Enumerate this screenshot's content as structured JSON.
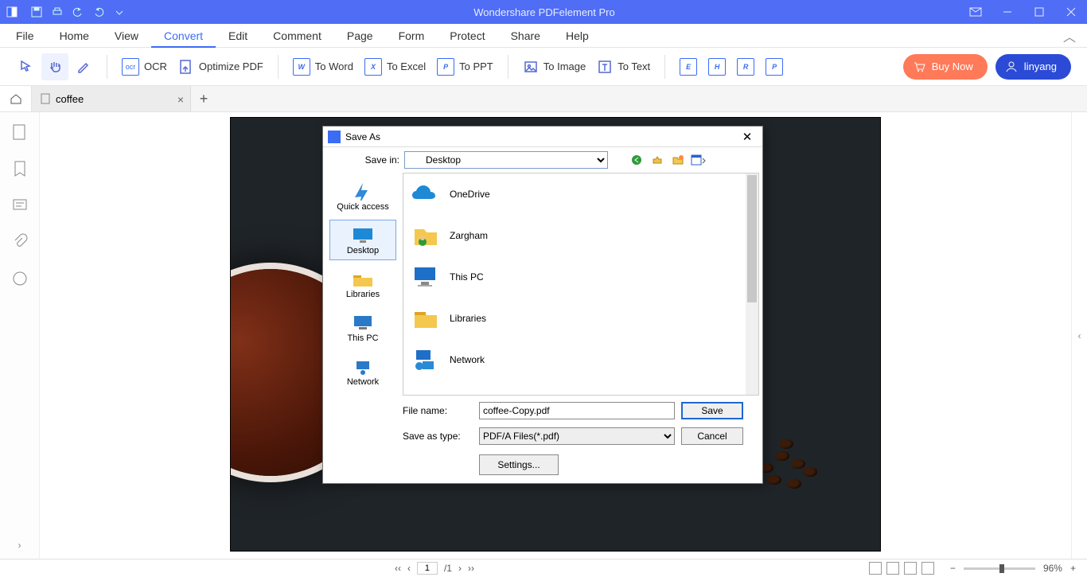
{
  "app": {
    "title": "Wondershare PDFelement Pro"
  },
  "qat": [
    "save",
    "print",
    "undo",
    "redo",
    "more"
  ],
  "menu": {
    "items": [
      "File",
      "Home",
      "View",
      "Convert",
      "Edit",
      "Comment",
      "Page",
      "Form",
      "Protect",
      "Share",
      "Help"
    ],
    "active_index": 3
  },
  "toolbar": {
    "ocr": "OCR",
    "optimize": "Optimize PDF",
    "to_word": "To Word",
    "to_excel": "To Excel",
    "to_ppt": "To PPT",
    "to_image": "To Image",
    "to_text": "To Text",
    "buy": "Buy Now",
    "user": "linyang"
  },
  "tabs": {
    "doc_name": "coffee"
  },
  "status": {
    "page_current": "1",
    "page_total": "/1",
    "zoom": "96%"
  },
  "dialog": {
    "title": "Save As",
    "savein_label": "Save in:",
    "savein_value": "Desktop",
    "places": [
      "Quick access",
      "Desktop",
      "Libraries",
      "This PC",
      "Network"
    ],
    "places_selected_index": 1,
    "files": [
      "OneDrive",
      "Zargham",
      "This PC",
      "Libraries",
      "Network"
    ],
    "filename_label": "File name:",
    "filename_value": "coffee-Copy.pdf",
    "type_label": "Save as type:",
    "type_value": "PDF/A Files(*.pdf)",
    "save_btn": "Save",
    "cancel_btn": "Cancel",
    "settings_btn": "Settings..."
  }
}
